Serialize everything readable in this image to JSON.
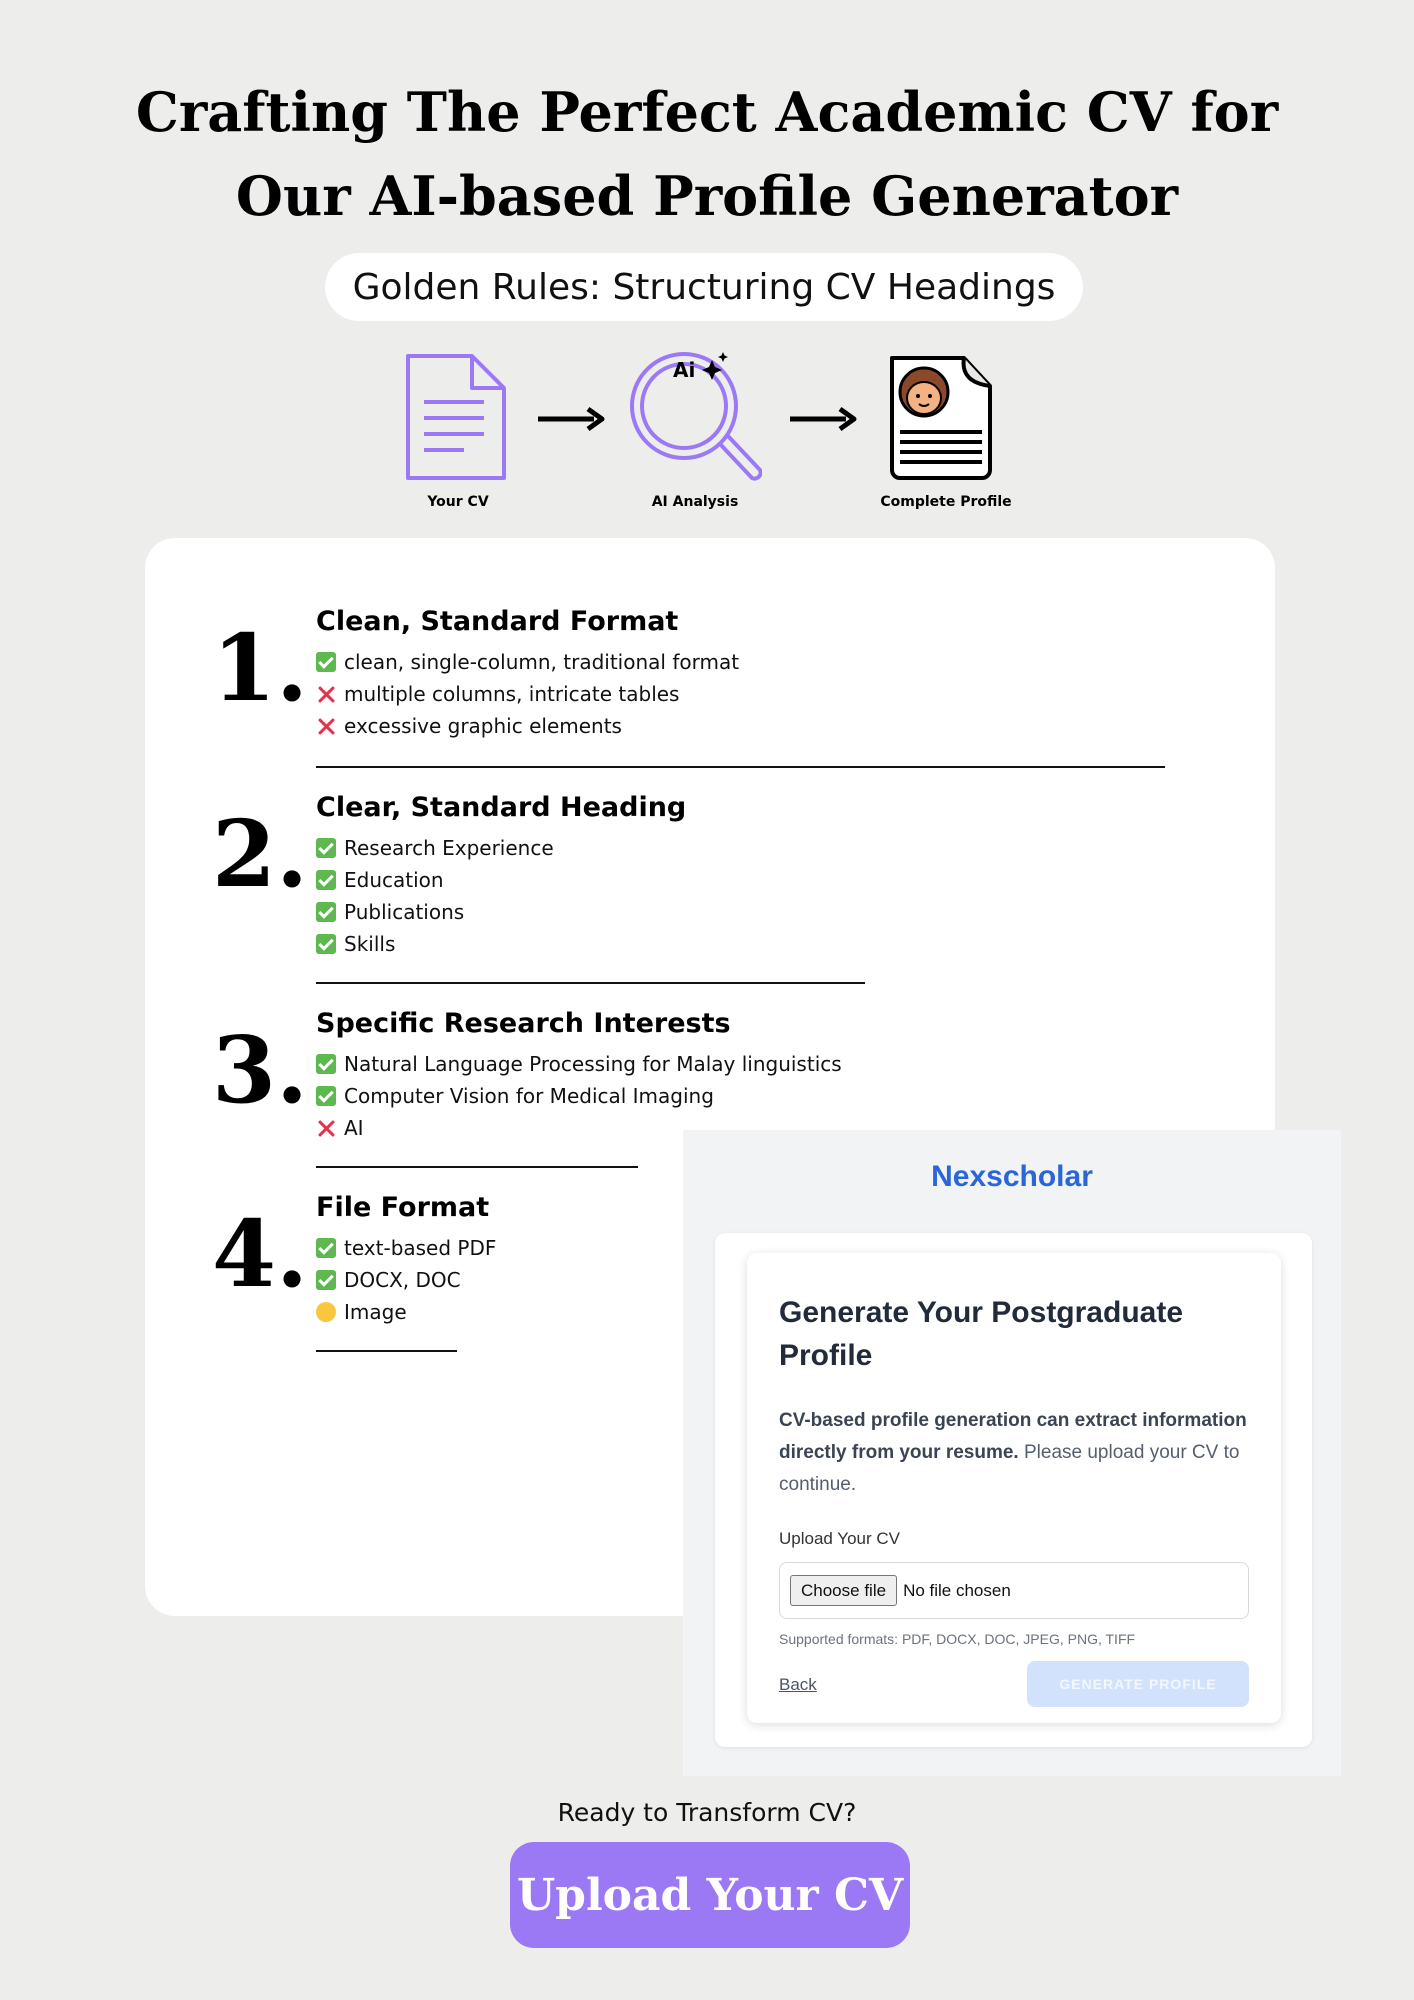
{
  "header": {
    "title_line1": "Crafting The Perfect Academic CV for",
    "title_line2": "Our AI-based Profile Generator",
    "subtitle": "Golden Rules: Structuring CV Headings"
  },
  "flow": [
    {
      "label": "Your CV",
      "icon": "document-icon"
    },
    {
      "label": "AI Analysis",
      "icon": "ai-magnifier-icon",
      "icon_text": "Ai"
    },
    {
      "label": "Complete Profile",
      "icon": "profile-document-icon"
    }
  ],
  "rules": [
    {
      "number": "1.",
      "heading": "Clean, Standard Format",
      "items": [
        {
          "mark": "check",
          "text": "clean, single-column, traditional format"
        },
        {
          "mark": "cross",
          "text": "multiple columns, intricate tables"
        },
        {
          "mark": "cross",
          "text": "excessive graphic elements"
        }
      ]
    },
    {
      "number": "2.",
      "heading": "Clear, Standard Heading",
      "items": [
        {
          "mark": "check",
          "text": "Research Experience"
        },
        {
          "mark": "check",
          "text": "Education"
        },
        {
          "mark": "check",
          "text": "Publications"
        },
        {
          "mark": "check",
          "text": "Skills"
        }
      ]
    },
    {
      "number": "3.",
      "heading": "Specific Research Interests",
      "items": [
        {
          "mark": "check",
          "text": "Natural Language Processing for Malay linguistics"
        },
        {
          "mark": "check",
          "text": "Computer Vision for Medical Imaging"
        },
        {
          "mark": "cross",
          "text": "AI"
        }
      ]
    },
    {
      "number": "4.",
      "heading": "File Format",
      "items": [
        {
          "mark": "check",
          "text": "text-based PDF"
        },
        {
          "mark": "check",
          "text": "DOCX, DOC"
        },
        {
          "mark": "dot",
          "text": "Image"
        }
      ]
    }
  ],
  "app": {
    "brand": "Nexscholar",
    "form_title": "Generate Your Postgraduate Profile",
    "desc_bold": "CV-based profile generation can extract information directly from your resume.",
    "desc_rest": " Please upload your CV to continue.",
    "upload_label": "Upload Your CV",
    "choose_file": "Choose file",
    "no_file": "No file chosen",
    "formats": "Supported formats: PDF, DOCX, DOC, JPEG, PNG, TIFF",
    "back": "Back",
    "generate": "GENERATE PROFILE"
  },
  "cta": {
    "label": "Ready to Transform CV?",
    "button": "Upload Your CV"
  },
  "colors": {
    "accent_purple": "#9b79f5",
    "brand_blue": "#2967d8",
    "check_green": "#5db84f",
    "cross_red": "#e0344c",
    "dot_yellow": "#f8c63f"
  }
}
